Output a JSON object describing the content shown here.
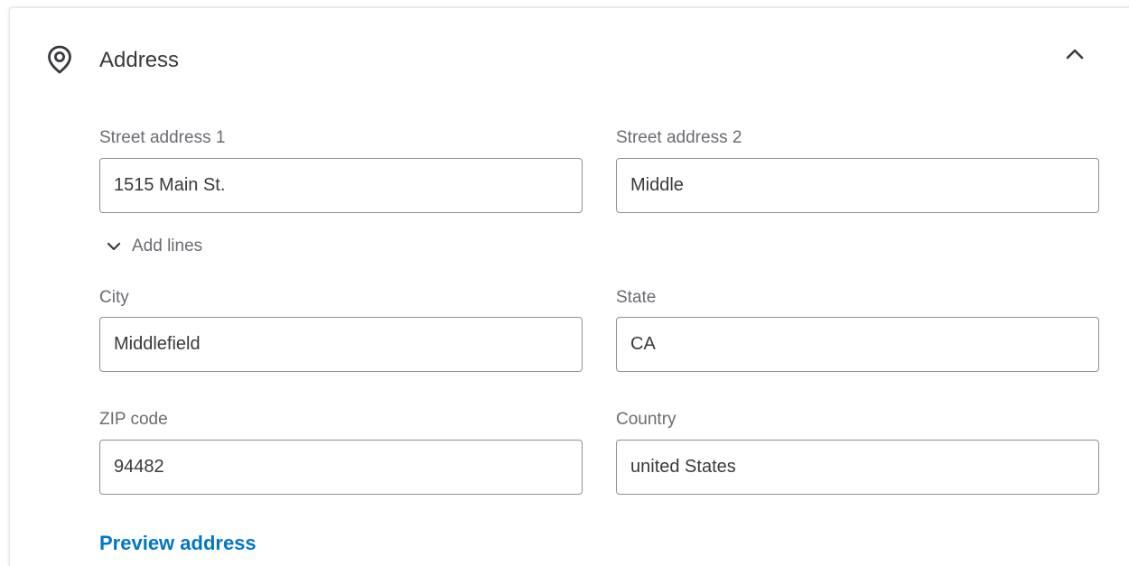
{
  "section": {
    "title": "Address",
    "icon": "location-pin-icon",
    "collapse_icon": "chevron-up-icon"
  },
  "fields": {
    "street1": {
      "label": "Street address 1",
      "value": "1515 Main St."
    },
    "street2": {
      "label": "Street address 2",
      "value": "Middle"
    },
    "city": {
      "label": "City",
      "value": "Middlefield"
    },
    "state": {
      "label": "State",
      "value": "CA"
    },
    "zip": {
      "label": "ZIP code",
      "value": "94482"
    },
    "country": {
      "label": "Country",
      "value": "united States"
    }
  },
  "add_lines": {
    "label": "Add lines",
    "icon": "chevron-down-icon"
  },
  "preview": {
    "label": "Preview address"
  },
  "colors": {
    "accent": "#0077c5",
    "text": "#393a3d",
    "label": "#6b6c72",
    "border": "#8d9096"
  }
}
